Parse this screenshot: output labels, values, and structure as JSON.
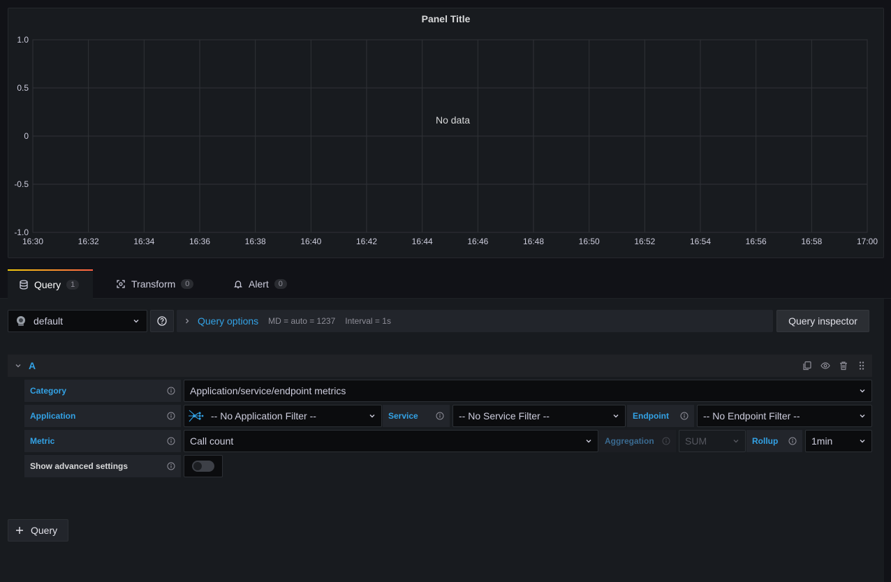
{
  "panel": {
    "title": "Panel Title",
    "no_data": "No data"
  },
  "chart_data": {
    "type": "line",
    "title": "Panel Title",
    "x_ticks": [
      "16:30",
      "16:32",
      "16:34",
      "16:36",
      "16:38",
      "16:40",
      "16:42",
      "16:44",
      "16:46",
      "16:48",
      "16:50",
      "16:52",
      "16:54",
      "16:56",
      "16:58",
      "17:00"
    ],
    "y_ticks": [
      "1.0",
      "0.5",
      "0",
      "-0.5",
      "-1.0"
    ],
    "ylim": [
      -1.0,
      1.0
    ],
    "series": [],
    "annotation": "No data",
    "grid": true
  },
  "tabs": [
    {
      "label": "Query",
      "count": "1",
      "icon": "database-icon"
    },
    {
      "label": "Transform",
      "count": "0",
      "icon": "transform-icon"
    },
    {
      "label": "Alert",
      "count": "0",
      "icon": "bell-icon"
    }
  ],
  "datasource": {
    "name": "default"
  },
  "query_options": {
    "label": "Query options",
    "md": "MD = auto = 1237",
    "interval": "Interval = 1s"
  },
  "query_inspector": "Query inspector",
  "query_row": {
    "letter": "A"
  },
  "fields": {
    "category_label": "Category",
    "category_value": "Application/service/endpoint metrics",
    "application_label": "Application",
    "application_value": "-- No Application Filter --",
    "service_label": "Service",
    "service_value": "-- No Service Filter --",
    "endpoint_label": "Endpoint",
    "endpoint_value": "-- No Endpoint Filter --",
    "metric_label": "Metric",
    "metric_value": "Call count",
    "aggregation_label": "Aggregation",
    "aggregation_value": "SUM",
    "rollup_label": "Rollup",
    "rollup_value": "1min",
    "advanced_label": "Show advanced settings"
  },
  "add_query": "Query",
  "colors": {
    "accent": "#33a2e5",
    "background": "#111217",
    "panel": "#181b1f"
  }
}
